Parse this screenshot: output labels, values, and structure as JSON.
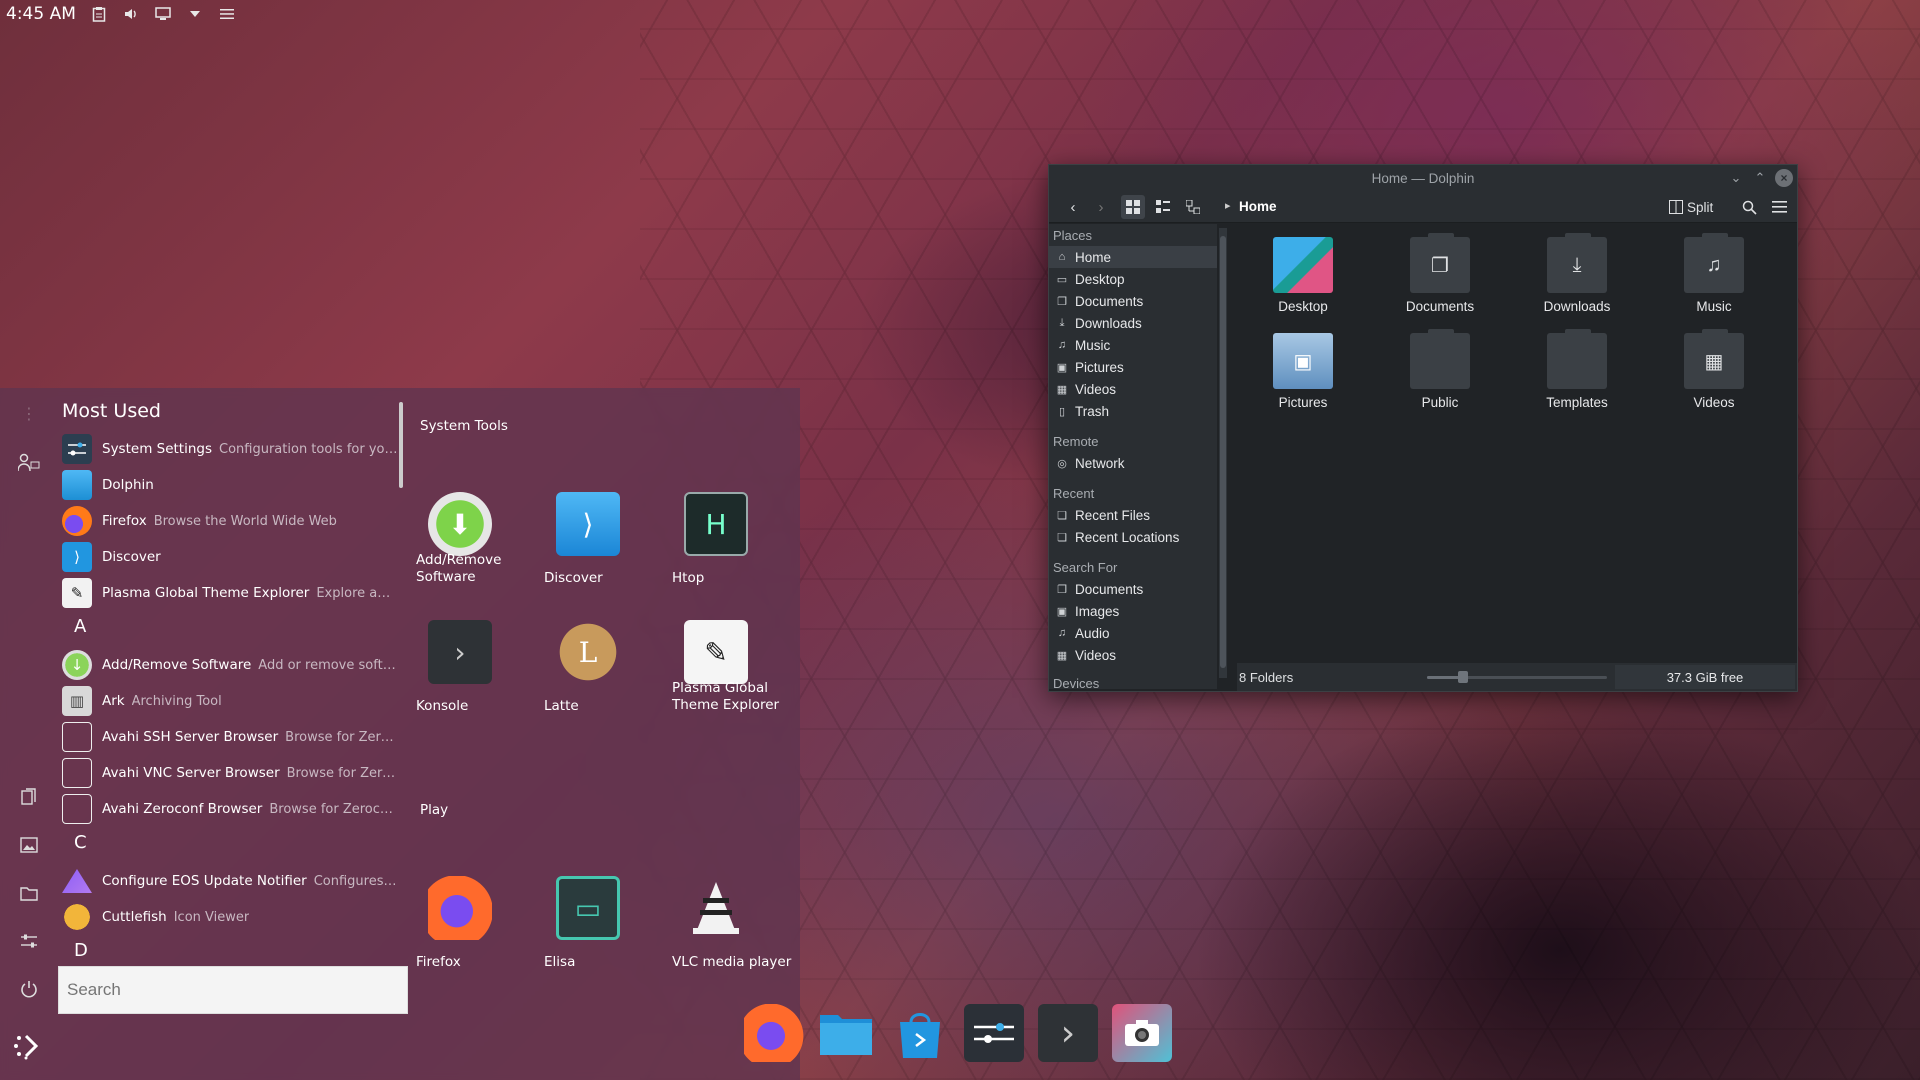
{
  "colors": {
    "accent": "#3daee9",
    "launcher_bg": "#5f3450",
    "dolphin_bg": "#202326"
  },
  "top_panel": {
    "clock": "4:45 AM",
    "tray_icons": [
      "clipboard-icon",
      "volume-icon",
      "display-icon",
      "tray-expand-icon",
      "panel-menu-icon"
    ]
  },
  "launcher": {
    "most_used_title": "Most Used",
    "search_placeholder": "Search",
    "list_items": [
      {
        "name": "System Settings",
        "desc": "Configuration tools for your ..."
      },
      {
        "name": "Dolphin",
        "desc": ""
      },
      {
        "name": "Firefox",
        "desc": "Browse the World Wide Web"
      },
      {
        "name": "Discover",
        "desc": ""
      },
      {
        "name": "Plasma Global Theme Explorer",
        "desc": "Explore and e..."
      },
      {
        "letter": "A"
      },
      {
        "name": "Add/Remove Software",
        "desc": "Add or remove softwa..."
      },
      {
        "name": "Ark",
        "desc": "Archiving Tool"
      },
      {
        "name": "Avahi SSH Server Browser",
        "desc": "Browse for Zeroco..."
      },
      {
        "name": "Avahi VNC Server Browser",
        "desc": "Browse for Zeroco..."
      },
      {
        "name": "Avahi Zeroconf Browser",
        "desc": "Browse for Zeroconf..."
      },
      {
        "letter": "C"
      },
      {
        "name": "Configure EOS Update Notifier",
        "desc": "Configures th..."
      },
      {
        "name": "Cuttlefish",
        "desc": "Icon Viewer"
      },
      {
        "letter": "D"
      }
    ],
    "grid_sections": [
      {
        "title": "System Tools",
        "tiles": [
          {
            "label": "Add/Remove Software",
            "icon": "add-remove-software-icon"
          },
          {
            "label": "Discover",
            "icon": "discover-icon"
          },
          {
            "label": "Htop",
            "icon": "htop-icon"
          },
          {
            "label": "Konsole",
            "icon": "konsole-icon"
          },
          {
            "label": "Latte",
            "icon": "latte-icon"
          },
          {
            "label": "Plasma Global Theme Explorer",
            "icon": "theme-explorer-icon"
          }
        ]
      },
      {
        "title": "Play",
        "tiles": [
          {
            "label": "Firefox",
            "icon": "firefox-icon"
          },
          {
            "label": "Elisa",
            "icon": "elisa-icon"
          },
          {
            "label": "VLC media player",
            "icon": "vlc-icon"
          }
        ]
      }
    ]
  },
  "taskbar": {
    "apps": [
      "firefox-icon",
      "dolphin-folder-icon",
      "discover-icon",
      "system-settings-icon",
      "konsole-icon",
      "spectacle-icon"
    ]
  },
  "dolphin": {
    "title": "Home — Dolphin",
    "breadcrumb": "Home",
    "split_label": "Split",
    "places_sections": [
      {
        "heading": "Places",
        "items": [
          "Home",
          "Desktop",
          "Documents",
          "Downloads",
          "Music",
          "Pictures",
          "Videos",
          "Trash"
        ]
      },
      {
        "heading": "Remote",
        "items": [
          "Network"
        ]
      },
      {
        "heading": "Recent",
        "items": [
          "Recent Files",
          "Recent Locations"
        ]
      },
      {
        "heading": "Search For",
        "items": [
          "Documents",
          "Images",
          "Audio",
          "Videos"
        ]
      },
      {
        "heading": "Devices",
        "items": []
      }
    ],
    "selected_place": "Home",
    "folders": [
      "Desktop",
      "Documents",
      "Downloads",
      "Music",
      "Pictures",
      "Public",
      "Templates",
      "Videos"
    ],
    "status_text": "8 Folders",
    "free_space": "37.3 GiB free",
    "zoom_level": 0.2
  }
}
